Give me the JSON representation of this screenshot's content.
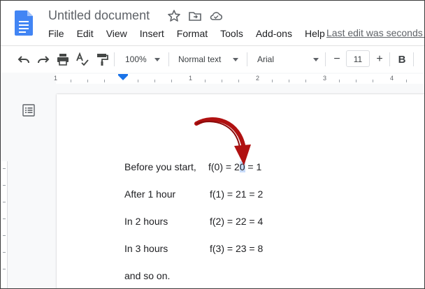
{
  "app": {
    "doc_title": "Untitled document",
    "last_edit": "Last edit was seconds ago"
  },
  "menu": [
    "File",
    "Edit",
    "View",
    "Insert",
    "Format",
    "Tools",
    "Add-ons",
    "Help"
  ],
  "toolbar": {
    "zoom": "100%",
    "style": "Normal text",
    "font": "Arial",
    "font_size": "11",
    "minus": "−",
    "plus": "+",
    "bold": "B"
  },
  "ruler": {
    "labels": [
      "1",
      "1",
      "2",
      "3",
      "4"
    ]
  },
  "document": {
    "lines": [
      {
        "left": "Before you start,",
        "pre": "f(0) = 2",
        "sel": "0",
        "post": " = 1"
      },
      {
        "left": "After 1 hour",
        "pre": "f(1) = 21 = 2",
        "sel": "",
        "post": ""
      },
      {
        "left": "In 2 hours",
        "pre": "f(2) = 22 = 4",
        "sel": "",
        "post": ""
      },
      {
        "left": "In 3 hours",
        "pre": "f(3) = 23 = 8",
        "sel": "",
        "post": ""
      },
      {
        "left": "and so on.",
        "pre": "",
        "sel": "",
        "post": ""
      }
    ]
  },
  "colors": {
    "accent": "#1a73e8",
    "annotation_arrow": "#b01111",
    "selection": "#c8dcfa"
  },
  "icons": [
    "docs-logo-icon",
    "star-icon",
    "move-folder-icon",
    "cloud-status-icon",
    "undo-icon",
    "redo-icon",
    "print-icon",
    "spellcheck-icon",
    "paint-format-icon",
    "document-outline-icon"
  ]
}
